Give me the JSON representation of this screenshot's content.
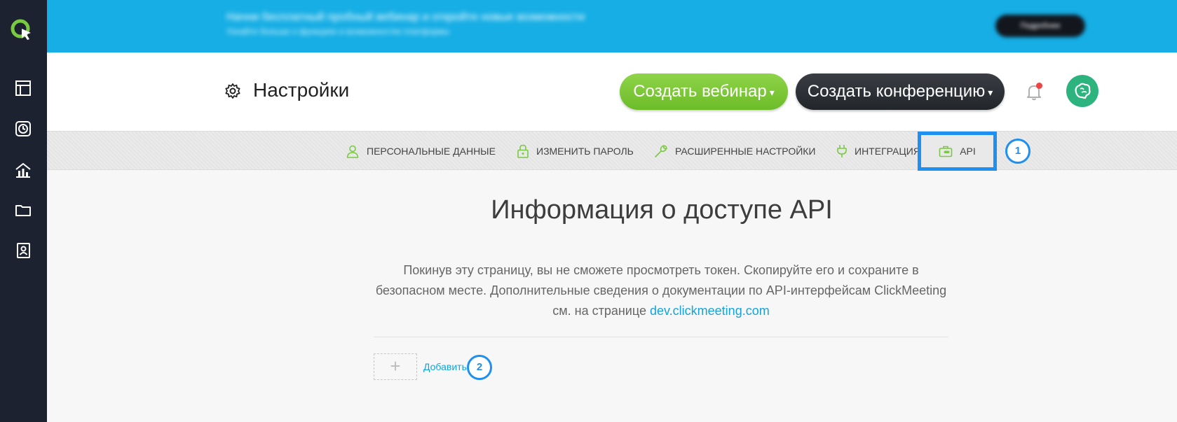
{
  "banner": {
    "text_line1": "Начни бесплатный пробный вебинар и откройте новые возможности",
    "text_line2": "Узнайте больше о функциях и возможностях платформы",
    "button_label": "Подробнее"
  },
  "header": {
    "title": "Настройки",
    "create_webinar_label": "Создать вебинар",
    "create_conference_label": "Создать конференцию",
    "caret": "▾"
  },
  "tabs": [
    {
      "label": "ПЕРСОНАЛЬНЫЕ ДАННЫЕ",
      "icon": "user-icon"
    },
    {
      "label": "ИЗМЕНИТЬ ПАРОЛЬ",
      "icon": "lock-icon"
    },
    {
      "label": "РАСШИРЕННЫЕ НАСТРОЙКИ",
      "icon": "wrench-icon"
    },
    {
      "label": "ИНТЕГРАЦИЯ",
      "icon": "plug-icon"
    },
    {
      "label": "API",
      "icon": "api-icon",
      "active": true
    }
  ],
  "callouts": {
    "one": "1",
    "two": "2"
  },
  "content": {
    "title": "Информация о доступе API",
    "desc_line1": "Покинув эту страницу, вы не сможете просмотреть токен. Скопируйте его и сохраните в",
    "desc_line2": "безопасном месте. Дополнительные сведения о документации по API-интерфейсам ClickMeeting",
    "desc_line3_prefix": "см. на странице ",
    "desc_link": "dev.clickmeeting.com",
    "add_plus": "+",
    "add_label": "Добавить"
  },
  "colors": {
    "accent_green": "#7ac943",
    "sidebar_bg": "#1c2230",
    "banner_bg": "#16aee5",
    "highlight_blue": "#1f8ff0",
    "link_blue": "#15a3d9",
    "notification_red": "#ee4444"
  }
}
